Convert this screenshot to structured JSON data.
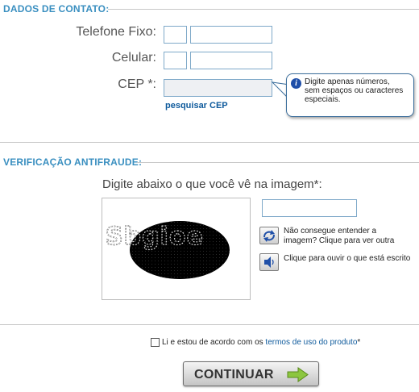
{
  "contact": {
    "section_title": "DADOS DE CONTATO:",
    "phone_label": "Telefone Fixo:",
    "mobile_label": "Celular:",
    "cep_label": "CEP *:",
    "search_cep_link": "pesquisar CEP",
    "cep_tooltip": "Digite apenas números, sem espaços ou caracteres especiais."
  },
  "antifraud": {
    "section_title": "VERIFICAÇÃO ANTIFRAUDE:",
    "instruction": "Digite abaixo o que você vê na imagem*:",
    "captcha_text": "Sbgioe",
    "reload_text": "Não consegue entender a imagem? Clique para ver outra",
    "audio_text": "Clique para ouvir o que está escrito"
  },
  "terms": {
    "prefix": "Li e estou de acordo com os ",
    "link": "termos de uso do produto",
    "suffix": "*"
  },
  "submit": {
    "label": "CONTINUAR"
  },
  "colors": {
    "section_title": "#3a8fc0",
    "link": "#0e5a9c",
    "input_border": "#7fa9c9",
    "arrow_green": "#8cc63f"
  },
  "icons": [
    "info-icon",
    "refresh-icon",
    "speaker-icon",
    "arrow-right-icon"
  ]
}
